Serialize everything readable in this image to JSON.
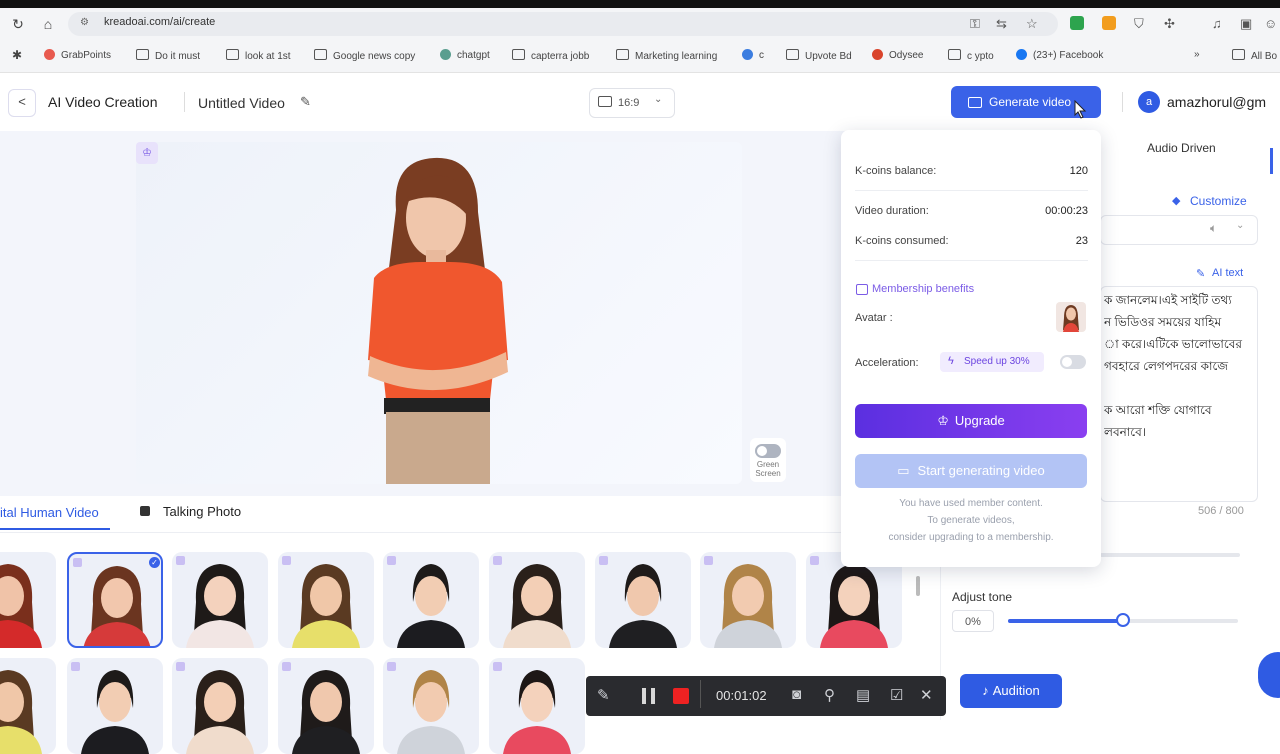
{
  "browser": {
    "url": "kreadoai.com/ai/create",
    "bookmarks": [
      {
        "label": "GrabPoints",
        "icon": "circle"
      },
      {
        "label": "Do it must",
        "icon": "folder"
      },
      {
        "label": "look at 1st",
        "icon": "folder"
      },
      {
        "label": "Google news copy",
        "icon": "folder"
      },
      {
        "label": "chatgpt",
        "icon": "circle"
      },
      {
        "label": "capterra jobb",
        "icon": "folder"
      },
      {
        "label": "Marketing learning",
        "icon": "folder"
      },
      {
        "label": "c",
        "icon": "circle"
      },
      {
        "label": "Upvote Bd",
        "icon": "folder"
      },
      {
        "label": "Odysee",
        "icon": "circle"
      },
      {
        "label": "c ypto",
        "icon": "folder"
      },
      {
        "label": "(23+) Facebook",
        "icon": "circle"
      },
      {
        "label": "All Bo",
        "icon": "folder"
      }
    ],
    "overflow": "»"
  },
  "header": {
    "back": "<",
    "title": "AI Video Creation",
    "video_name": "Untitled Video",
    "aspect_ratio": "16:9",
    "generate_label": "Generate video",
    "avatar_letter": "a",
    "email": "amazhorul@gm"
  },
  "stage": {
    "green_screen_label": "Green Screen"
  },
  "tabs": [
    {
      "label": "ital Human Video"
    },
    {
      "label": "Talking Photo"
    }
  ],
  "right_panel": {
    "audio_driven": "Audio Driven",
    "customize": "Customize",
    "ai_text": "AI text",
    "bangla_lines": [
      "ক জানলেম।এই সাইটি তথ্য",
      "ন ভিডিওর সময়ের যাহিম",
      "া করে।এটিকে ভালোভাবের",
      "গবহারে লেগপদরের কাজে",
      "",
      "ক আরো শক্তি যোগাবে",
      "লবনাবে।"
    ],
    "char_count": "506 / 800",
    "adjust_tone": "Adjust tone",
    "tone_value": "0%",
    "tone_level": 0.5,
    "audition": "Audition"
  },
  "popover": {
    "kcoins_balance_label": "K-coins balance:",
    "kcoins_balance": "120",
    "duration_label": "Video duration:",
    "duration": "00:00:23",
    "consumed_label": "K-coins consumed:",
    "consumed": "23",
    "membership": "Membership benefits",
    "avatar_label": "Avatar :",
    "acceleration_label": "Acceleration:",
    "speed_up": "Speed up 30%",
    "upgrade": "Upgrade",
    "start": "Start generating video",
    "note": [
      "You have used member content.",
      "To generate videos,",
      "consider upgrading to a membership."
    ]
  },
  "recorder": {
    "time": "00:01:02"
  },
  "colors": {
    "brand": "#3a62e8",
    "purple": "#7b5ce6"
  }
}
